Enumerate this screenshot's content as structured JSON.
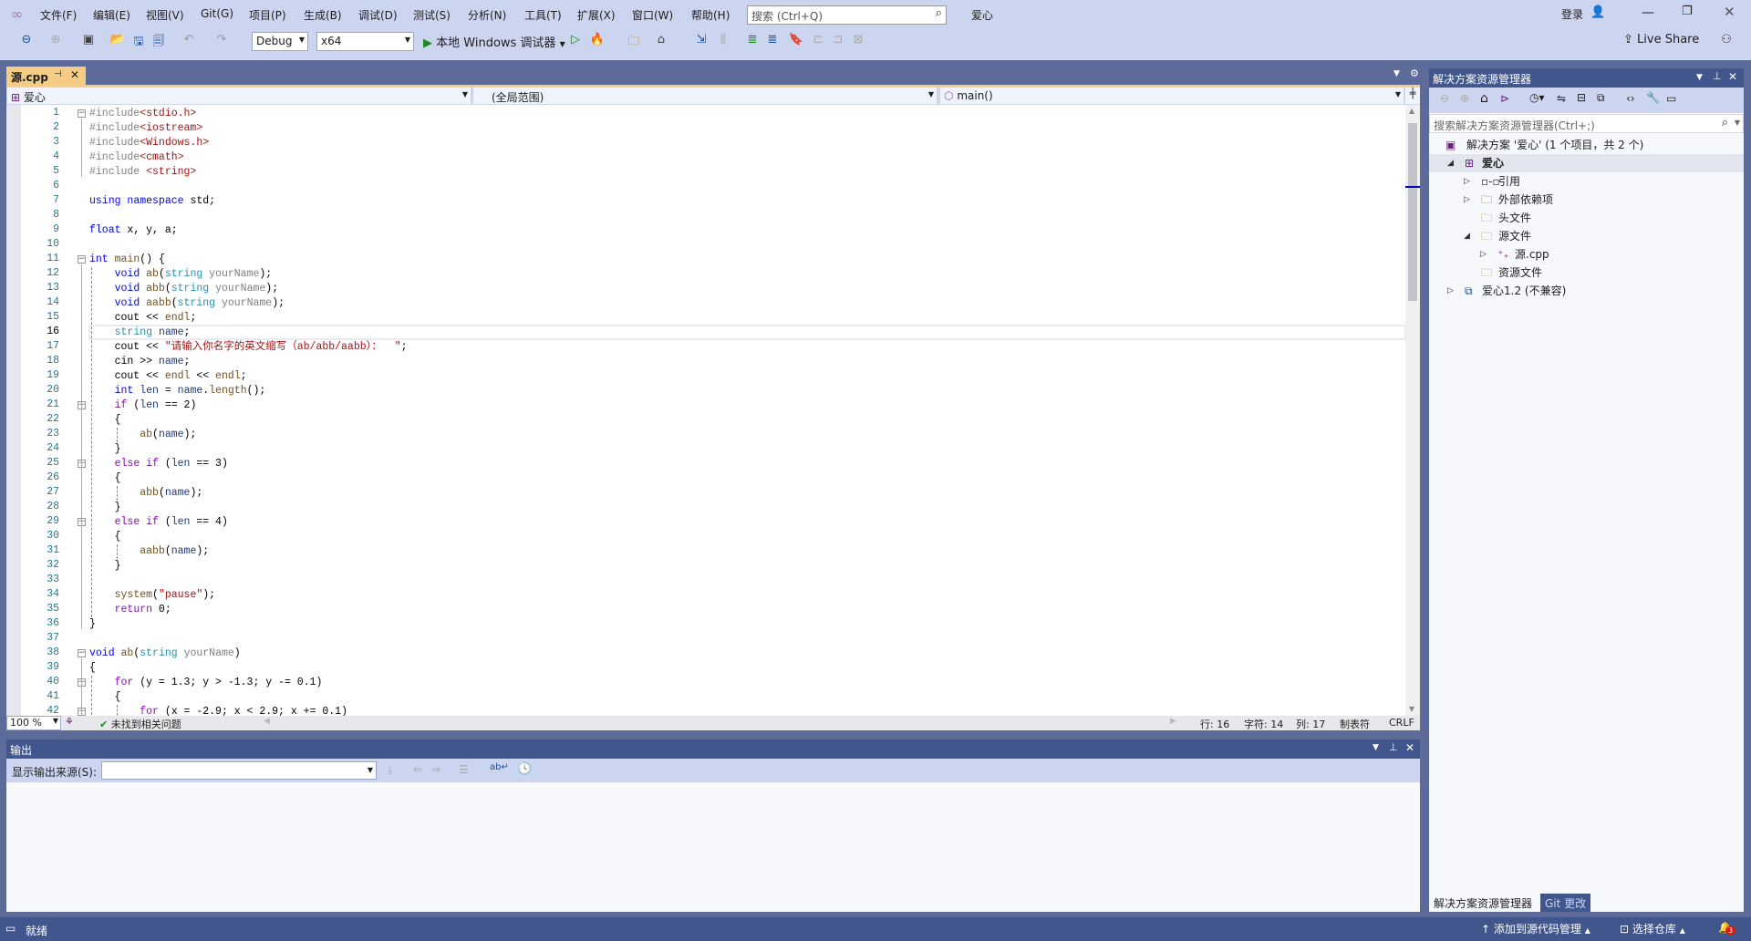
{
  "menu": [
    "文件(F)",
    "编辑(E)",
    "视图(V)",
    "Git(G)",
    "项目(P)",
    "生成(B)",
    "调试(D)",
    "测试(S)",
    "分析(N)",
    "工具(T)",
    "扩展(X)",
    "窗口(W)",
    "帮助(H)"
  ],
  "search_placeholder": "搜索 (Ctrl+Q)",
  "solution_name": "爱心",
  "login": "登录",
  "toolbar": {
    "config": "Debug",
    "platform": "x64",
    "run_label": "本地 Windows 调试器",
    "live_share": "Live Share"
  },
  "doc_tab": {
    "title": "源.cpp"
  },
  "navbar": {
    "project": "爱心",
    "scope": "(全局范围)",
    "member": "main()"
  },
  "editor": {
    "current_line": 16,
    "lines": [
      [
        [
          "p",
          "#include"
        ],
        [
          "s",
          "<stdio.h>"
        ]
      ],
      [
        [
          "p",
          "#include"
        ],
        [
          "s",
          "<iostream>"
        ]
      ],
      [
        [
          "p",
          "#include"
        ],
        [
          "s",
          "<Windows.h>"
        ]
      ],
      [
        [
          "p",
          "#include"
        ],
        [
          "s",
          "<cmath>"
        ]
      ],
      [
        [
          "p",
          "#include "
        ],
        [
          "s",
          "<string>"
        ]
      ],
      [],
      [
        [
          "k",
          "using"
        ],
        [
          "n",
          " "
        ],
        [
          "k",
          "namespace"
        ],
        [
          "n",
          " std;"
        ]
      ],
      [],
      [
        [
          "k",
          "float"
        ],
        [
          "n",
          " x, y, a;"
        ]
      ],
      [],
      [
        [
          "k",
          "int"
        ],
        [
          "n",
          " "
        ],
        [
          "f",
          "main"
        ],
        [
          "n",
          "() {"
        ]
      ],
      [
        [
          "n",
          "    "
        ],
        [
          "k",
          "void"
        ],
        [
          "n",
          " "
        ],
        [
          "f",
          "ab"
        ],
        [
          "n",
          "("
        ],
        [
          "t",
          "string"
        ],
        [
          "n",
          " "
        ],
        [
          "m",
          "yourName"
        ],
        [
          "n",
          ");"
        ]
      ],
      [
        [
          "n",
          "    "
        ],
        [
          "k",
          "void"
        ],
        [
          "n",
          " "
        ],
        [
          "f",
          "abb"
        ],
        [
          "n",
          "("
        ],
        [
          "t",
          "string"
        ],
        [
          "n",
          " "
        ],
        [
          "m",
          "yourName"
        ],
        [
          "n",
          ");"
        ]
      ],
      [
        [
          "n",
          "    "
        ],
        [
          "k",
          "void"
        ],
        [
          "n",
          " "
        ],
        [
          "f",
          "aabb"
        ],
        [
          "n",
          "("
        ],
        [
          "t",
          "string"
        ],
        [
          "n",
          " "
        ],
        [
          "m",
          "yourName"
        ],
        [
          "n",
          ");"
        ]
      ],
      [
        [
          "n",
          "    cout << "
        ],
        [
          "f",
          "endl"
        ],
        [
          "n",
          ";"
        ]
      ],
      [
        [
          "n",
          "    "
        ],
        [
          "t",
          "string"
        ],
        [
          "n",
          " "
        ],
        [
          "v",
          "name"
        ],
        [
          "n",
          ";"
        ]
      ],
      [
        [
          "n",
          "    cout << "
        ],
        [
          "s",
          "\"请输入你名字的英文缩写（ab/abb/aabb）：  \""
        ],
        [
          "n",
          ";"
        ]
      ],
      [
        [
          "n",
          "    cin >> "
        ],
        [
          "v",
          "name"
        ],
        [
          "n",
          ";"
        ]
      ],
      [
        [
          "n",
          "    cout << "
        ],
        [
          "f",
          "endl"
        ],
        [
          "n",
          " << "
        ],
        [
          "f",
          "endl"
        ],
        [
          "n",
          ";"
        ]
      ],
      [
        [
          "n",
          "    "
        ],
        [
          "k",
          "int"
        ],
        [
          "n",
          " "
        ],
        [
          "v",
          "len"
        ],
        [
          "n",
          " = "
        ],
        [
          "v",
          "name"
        ],
        [
          "n",
          "."
        ],
        [
          "f",
          "length"
        ],
        [
          "n",
          "();"
        ]
      ],
      [
        [
          "n",
          "    "
        ],
        [
          "c",
          "if"
        ],
        [
          "n",
          " ("
        ],
        [
          "v",
          "len"
        ],
        [
          "n",
          " == 2)"
        ]
      ],
      [
        [
          "n",
          "    {"
        ]
      ],
      [
        [
          "n",
          "        "
        ],
        [
          "f",
          "ab"
        ],
        [
          "n",
          "("
        ],
        [
          "v",
          "name"
        ],
        [
          "n",
          ");"
        ]
      ],
      [
        [
          "n",
          "    }"
        ]
      ],
      [
        [
          "n",
          "    "
        ],
        [
          "c",
          "else if"
        ],
        [
          "n",
          " ("
        ],
        [
          "v",
          "len"
        ],
        [
          "n",
          " == 3)"
        ]
      ],
      [
        [
          "n",
          "    {"
        ]
      ],
      [
        [
          "n",
          "        "
        ],
        [
          "f",
          "abb"
        ],
        [
          "n",
          "("
        ],
        [
          "v",
          "name"
        ],
        [
          "n",
          ");"
        ]
      ],
      [
        [
          "n",
          "    }"
        ]
      ],
      [
        [
          "n",
          "    "
        ],
        [
          "c",
          "else if"
        ],
        [
          "n",
          " ("
        ],
        [
          "v",
          "len"
        ],
        [
          "n",
          " == 4)"
        ]
      ],
      [
        [
          "n",
          "    {"
        ]
      ],
      [
        [
          "n",
          "        "
        ],
        [
          "f",
          "aabb"
        ],
        [
          "n",
          "("
        ],
        [
          "v",
          "name"
        ],
        [
          "n",
          ");"
        ]
      ],
      [
        [
          "n",
          "    }"
        ]
      ],
      [],
      [
        [
          "n",
          "    "
        ],
        [
          "f",
          "system"
        ],
        [
          "n",
          "("
        ],
        [
          "s",
          "\"pause\""
        ],
        [
          "n",
          ");"
        ]
      ],
      [
        [
          "n",
          "    "
        ],
        [
          "c",
          "return"
        ],
        [
          "n",
          " 0;"
        ]
      ],
      [
        [
          "n",
          "}"
        ]
      ],
      [],
      [
        [
          "k",
          "void"
        ],
        [
          "n",
          " "
        ],
        [
          "f",
          "ab"
        ],
        [
          "n",
          "("
        ],
        [
          "t",
          "string"
        ],
        [
          "n",
          " "
        ],
        [
          "m",
          "yourName"
        ],
        [
          "n",
          ")"
        ]
      ],
      [
        [
          "n",
          "{"
        ]
      ],
      [
        [
          "n",
          "    "
        ],
        [
          "c",
          "for"
        ],
        [
          "n",
          " (y = 1.3; y > -1.3; y -= 0.1)"
        ]
      ],
      [
        [
          "n",
          "    {"
        ]
      ],
      [
        [
          "n",
          "        "
        ],
        [
          "c",
          "for"
        ],
        [
          "n",
          " (x = -2.9; x < 2.9; x += 0.1)"
        ]
      ]
    ],
    "fold_lines": [
      1,
      11,
      21,
      25,
      29,
      38,
      40,
      42
    ]
  },
  "editor_status": {
    "zoom": "100 %",
    "issues": "未找到相关问题",
    "row": "行: 16",
    "char": "字符: 14",
    "col": "列: 17",
    "indent": "制表符",
    "eol": "CRLF"
  },
  "output": {
    "title": "输出",
    "source_label": "显示输出来源(S):",
    "source_value": ""
  },
  "solution_explorer": {
    "title": "解决方案资源管理器",
    "search_placeholder": "搜索解决方案资源管理器(Ctrl+;)",
    "tree": [
      {
        "label": "解决方案 '爱心' (1 个项目，共 2 个)",
        "level": 0,
        "arrow": "",
        "icon": "solution-icon"
      },
      {
        "label": "爱心",
        "level": 0,
        "arrow": "expanded",
        "icon": "cpp-project-icon",
        "bold": true,
        "selected": true
      },
      {
        "label": "引用",
        "level": 1,
        "arrow": "collapsed",
        "icon": "references-icon"
      },
      {
        "label": "外部依赖项",
        "level": 1,
        "arrow": "collapsed",
        "icon": "external-deps-icon"
      },
      {
        "label": "头文件",
        "level": 1,
        "arrow": "",
        "icon": "filter-folder-icon"
      },
      {
        "label": "源文件",
        "level": 1,
        "arrow": "expanded",
        "icon": "filter-folder-icon"
      },
      {
        "label": "源.cpp",
        "level": 2,
        "arrow": "collapsed",
        "icon": "cpp-file-icon"
      },
      {
        "label": "资源文件",
        "level": 1,
        "arrow": "",
        "icon": "filter-folder-icon"
      },
      {
        "label": "爱心1.2 (不兼容)",
        "level": 0,
        "arrow": "collapsed",
        "icon": "incompatible-project-icon"
      }
    ],
    "tabs": [
      "解决方案资源管理器",
      "Git 更改"
    ]
  },
  "status": {
    "ready": "就绪",
    "add_source_control": "添加到源代码管理",
    "select_repo": "选择仓库",
    "notifications": "3"
  },
  "colors": {
    "frame": "#5d6b99",
    "chrome": "#ccd5f0",
    "tool_title": "#40568d",
    "active_tab": "#f5cc84",
    "status_bar": "#40568d"
  }
}
